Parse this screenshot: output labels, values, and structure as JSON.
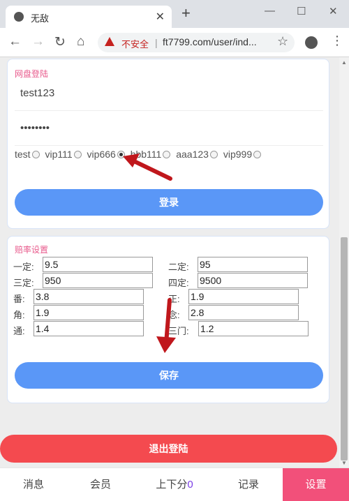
{
  "browser": {
    "tab_title": "无敌",
    "new_tab": "+",
    "security_label": "不安全",
    "url": "ft7799.com/user/ind..."
  },
  "login_card": {
    "title": "网盘登陆",
    "username": "test123",
    "password": "••••••••",
    "accounts": [
      {
        "label": "test",
        "checked": false
      },
      {
        "label": "vip111",
        "checked": false
      },
      {
        "label": "vip666",
        "checked": true
      },
      {
        "label": "bbb111",
        "checked": false
      },
      {
        "label": "aaa123",
        "checked": false
      },
      {
        "label": "vip999",
        "checked": false
      }
    ],
    "login_button": "登录"
  },
  "odds_card": {
    "title": "赔率设置",
    "fields": {
      "yiding": {
        "label": "一定:",
        "value": "9.5"
      },
      "erding": {
        "label": "二定:",
        "value": "95"
      },
      "sanding": {
        "label": "三定:",
        "value": "950"
      },
      "siding": {
        "label": "四定:",
        "value": "9500"
      },
      "fan": {
        "label": "番:",
        "value": "3.8"
      },
      "zheng": {
        "label": "正:",
        "value": "1.9"
      },
      "jiao": {
        "label": "角:",
        "value": "1.9"
      },
      "nian": {
        "label": "念:",
        "value": "2.8"
      },
      "tong": {
        "label": "通:",
        "value": "1.4"
      },
      "sanmen": {
        "label": "三门:",
        "value": "1.2"
      }
    },
    "save_button": "保存"
  },
  "logout_button": "退出登陆",
  "bottom_nav": {
    "messages": "消息",
    "members": "会员",
    "credit": "上下分",
    "credit_count": "0",
    "records": "记录",
    "settings": "设置"
  },
  "colors": {
    "accent_blue": "#5a97f7",
    "logout_red": "#f44a4f",
    "active_pink": "#f2507a",
    "title_pink": "#e85a8c",
    "annotation_red": "#c0171c"
  }
}
